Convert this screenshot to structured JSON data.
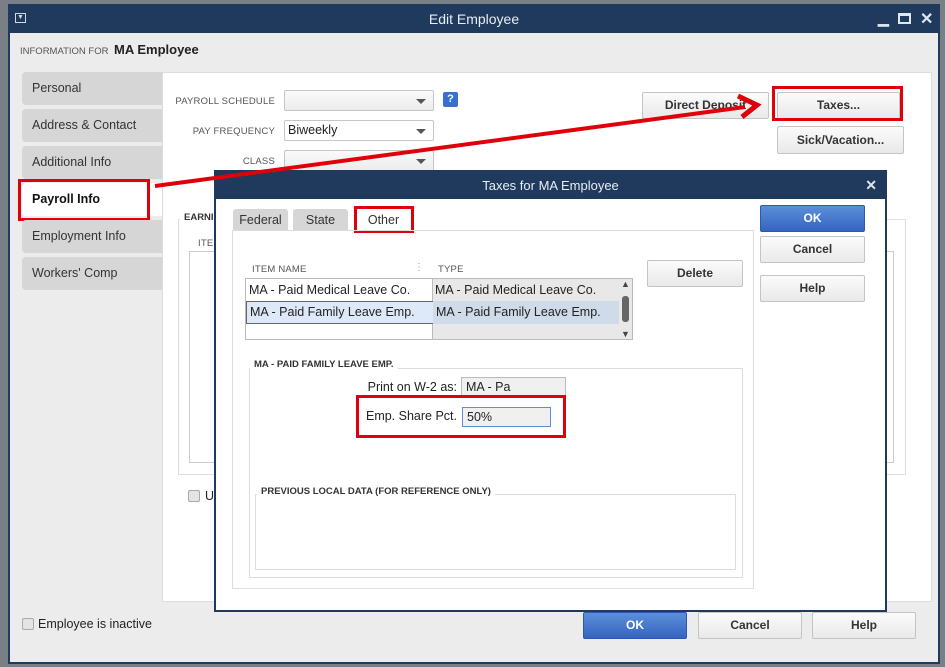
{
  "window": {
    "title": "Edit Employee",
    "info_label": "INFORMATION FOR",
    "employee_name": "MA Employee"
  },
  "sidebar": {
    "items": [
      {
        "label": "Personal"
      },
      {
        "label": "Address & Contact"
      },
      {
        "label": "Additional Info"
      },
      {
        "label": "Payroll Info",
        "selected": true
      },
      {
        "label": "Employment Info"
      },
      {
        "label": "Workers' Comp"
      }
    ]
  },
  "payroll": {
    "schedule_label": "PAYROLL SCHEDULE",
    "schedule_value": "",
    "frequency_label": "PAY FREQUENCY",
    "frequency_value": "Biweekly",
    "class_label": "CLASS",
    "class_value": "",
    "earnings_label": "EARNI",
    "item_header": "ITEM",
    "use_checkbox_label": "Us",
    "direct_deposit": "Direct Deposit",
    "taxes": "Taxes...",
    "sick_vacation": "Sick/Vacation..."
  },
  "footer": {
    "inactive_label": "Employee is inactive",
    "ok": "OK",
    "cancel": "Cancel",
    "help": "Help"
  },
  "taxes_dialog": {
    "title": "Taxes for MA Employee",
    "tabs": [
      {
        "label": "Federal"
      },
      {
        "label": "State"
      },
      {
        "label": "Other",
        "selected": true
      }
    ],
    "columns": [
      "ITEM NAME",
      "TYPE"
    ],
    "rows": [
      {
        "name": "MA - Paid Medical Leave Co.",
        "type": "MA - Paid Medical Leave Co."
      },
      {
        "name": "MA - Paid Family Leave Emp.",
        "type": "MA - Paid Family Leave Emp.",
        "selected": true
      }
    ],
    "delete": "Delete",
    "ok": "OK",
    "cancel": "Cancel",
    "help": "Help",
    "detail_title": "MA - PAID FAMILY LEAVE EMP.",
    "w2_label": "Print on W-2 as:",
    "w2_value": "MA - Pa",
    "share_label": "Emp. Share Pct.",
    "share_value": "50%",
    "previous_title": "PREVIOUS LOCAL DATA (FOR REFERENCE ONLY)"
  },
  "colors": {
    "titlebar": "#1f3a5c",
    "highlight": "#e0000a",
    "primary_button": "#3f6fcb",
    "selected_row": "#dde9f8"
  }
}
